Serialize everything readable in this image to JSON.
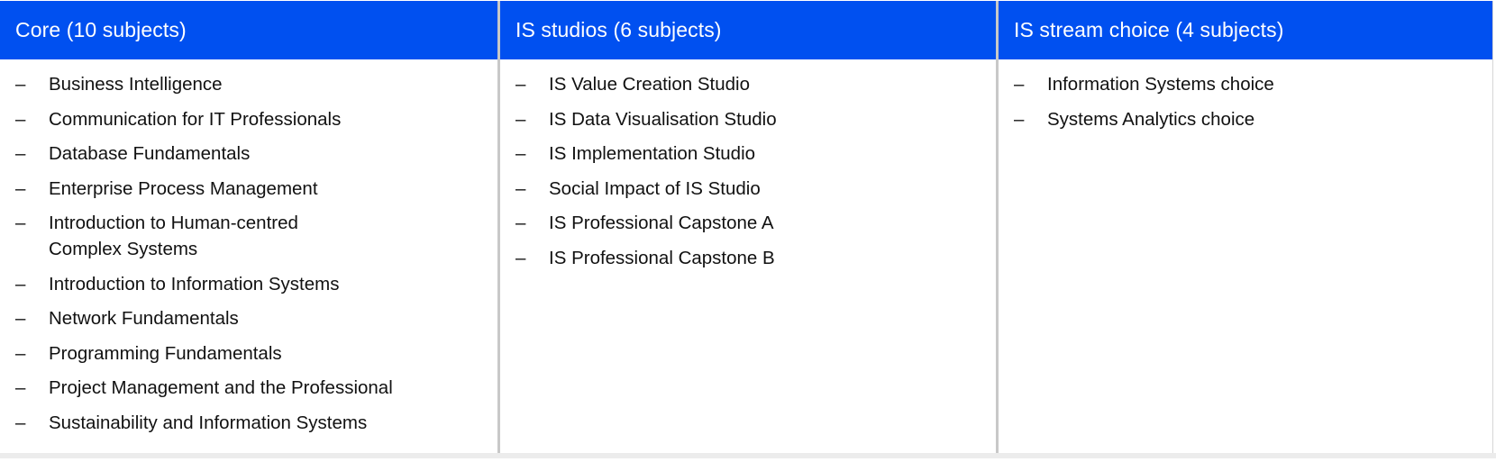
{
  "columns": [
    {
      "header": "Core (10 subjects)",
      "items": [
        "Business Intelligence",
        "Communication for IT Professionals",
        "Database Fundamentals",
        "Enterprise Process Management",
        "Introduction to Human-centred Complex Systems",
        "Introduction to Information Systems",
        "Network Fundamentals",
        "Programming Fundamentals",
        "Project Management and the Professional",
        "Sustainability and Information Systems"
      ]
    },
    {
      "header": "IS studios (6 subjects)",
      "items": [
        "IS Value Creation Studio",
        "IS Data Visualisation Studio",
        "IS Implementation Studio",
        "Social Impact of IS Studio",
        "IS Professional Capstone A",
        "IS Professional Capstone B"
      ]
    },
    {
      "header": "IS stream choice (4 subjects)",
      "items": [
        "Information Systems choice",
        "Systems Analytics choice"
      ]
    }
  ],
  "bullet_glyph": "–",
  "colors": {
    "header_background": "#0050f0",
    "header_text": "#ffffff",
    "body_text": "#111111",
    "divider": "#c8c8c8"
  }
}
